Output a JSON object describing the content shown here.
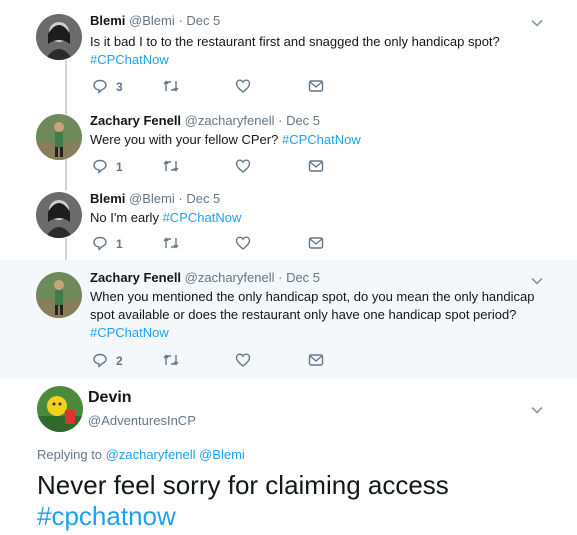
{
  "tweets": [
    {
      "name": "Blemi",
      "handle": "@Blemi",
      "dot": "·",
      "date": "Dec 5",
      "text": "Is it bad I to to the restaurant first and snagged the only handicap spot?",
      "hashtag": "#CPChatNow",
      "reply_count": "3"
    },
    {
      "name": "Zachary Fenell",
      "handle": "@zacharyfenell",
      "dot": "·",
      "date": "Dec 5",
      "text": "Were you with your fellow CPer?",
      "hashtag": "#CPChatNow",
      "reply_count": "1"
    },
    {
      "name": "Blemi",
      "handle": "@Blemi",
      "dot": "·",
      "date": "Dec 5",
      "text": "No I'm early",
      "hashtag": "#CPChatNow",
      "reply_count": "1"
    },
    {
      "name": "Zachary Fenell",
      "handle": "@zacharyfenell",
      "dot": "·",
      "date": "Dec 5",
      "text_line1": "When you mentioned the only handicap spot, do you mean the only handicap",
      "text_line2": "spot available or does the restaurant only have one handicap spot period?",
      "hashtag": "#CPChatNow",
      "reply_count": "2"
    }
  ],
  "main": {
    "name": "Devin",
    "handle": "@AdventuresInCP",
    "replying_prefix": "Replying to",
    "replying_user1": "@zacharyfenell",
    "replying_user2": "@Blemi",
    "text": "Never feel sorry for claiming access",
    "hashtag": "#cpchatnow"
  },
  "colors": {
    "link": "#1da1f2",
    "secondary": "#657786",
    "highlight_bg": "#f5f8fa",
    "thread_line": "#ccd6dd"
  },
  "icons": [
    "reply-icon",
    "retweet-icon",
    "like-icon",
    "direct-message-icon",
    "chevron-down-icon"
  ]
}
